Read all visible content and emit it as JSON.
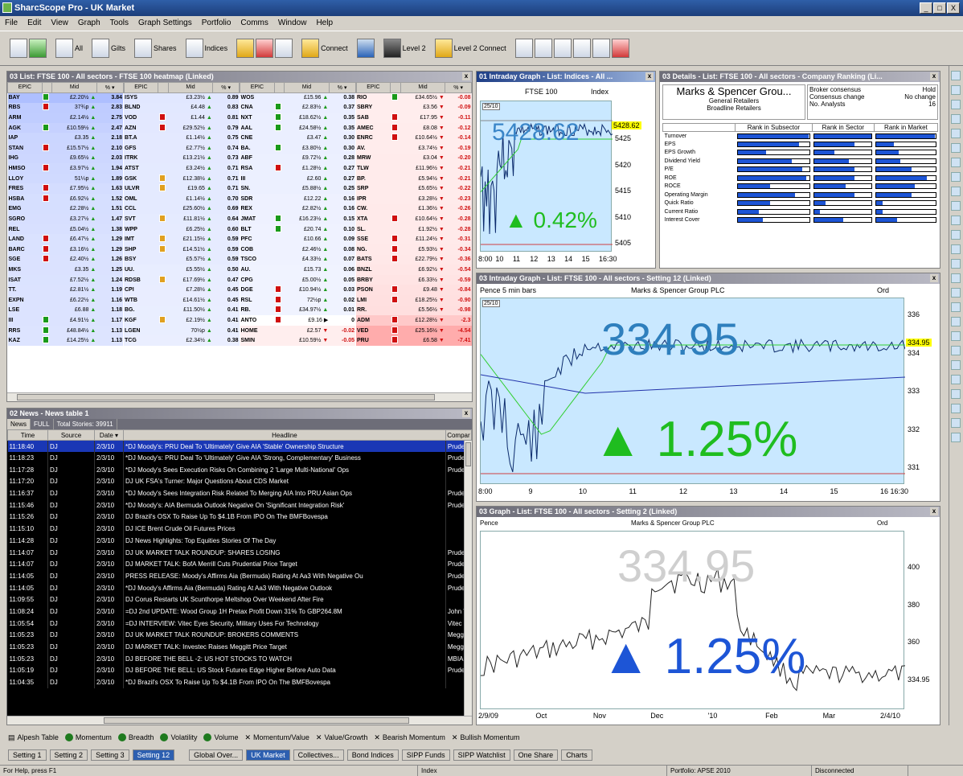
{
  "app": {
    "title": "SharcScope Pro - UK Market",
    "controls": [
      "_",
      "□",
      "X"
    ]
  },
  "menu": [
    "File",
    "Edit",
    "View",
    "Graph",
    "Tools",
    "Graph Settings",
    "Portfolio",
    "Comms",
    "Window",
    "Help"
  ],
  "toolbar": {
    "all": "All",
    "gilts": "Gilts",
    "shares": "Shares",
    "indices": "Indices",
    "connect": "Connect",
    "level2": "Level 2",
    "level2connect": "Level 2 Connect"
  },
  "heatmap": {
    "title": "03 List: FTSE 100 - All sectors - FTSE 100 heatmap (Linked)",
    "headers": [
      "EPIC",
      "",
      "Mid",
      "% ▾"
    ],
    "columns": [
      [
        [
          "BAY",
          "up",
          "£2.20½",
          "▲",
          "3.84"
        ],
        [
          "RBS",
          "dn",
          "37¾p",
          "▲",
          "2.83"
        ],
        [
          "ARM",
          "",
          "£2.14½",
          "▲",
          "2.75"
        ],
        [
          "AGK",
          "up",
          "£10.59½",
          "▲",
          "2.47"
        ],
        [
          "IAP",
          "",
          "£3.35",
          "▲",
          "2.18"
        ],
        [
          "STAN",
          "dn",
          "£15.57½",
          "▲",
          "2.10"
        ],
        [
          "IHG",
          "",
          "£9.65½",
          "▲",
          "2.03"
        ],
        [
          "HMSO",
          "dn",
          "£3.97½",
          "▲",
          "1.94"
        ],
        [
          "LLOY",
          "",
          "51¼p",
          "▲",
          "1.89"
        ],
        [
          "FRES",
          "dn",
          "£7.95½",
          "▲",
          "1.63"
        ],
        [
          "HSBA",
          "dn",
          "£6.92½",
          "▲",
          "1.52"
        ],
        [
          "EMG",
          "",
          "£2.28½",
          "▲",
          "1.51"
        ],
        [
          "SGRO",
          "",
          "£3.27½",
          "▲",
          "1.47"
        ],
        [
          "REL",
          "",
          "£5.04½",
          "▲",
          "1.38"
        ],
        [
          "LAND",
          "dn",
          "£6.47½",
          "▲",
          "1.29"
        ],
        [
          "BARC",
          "dn",
          "£3.16½",
          "▲",
          "1.29"
        ],
        [
          "SGE",
          "dn",
          "£2.40½",
          "▲",
          "1.26"
        ],
        [
          "MKS",
          "",
          "£3.35",
          "▲",
          "1.25"
        ],
        [
          "ISAT",
          "",
          "£7.52½",
          "▲",
          "1.24"
        ],
        [
          "TT.",
          "",
          "£2.81½",
          "▲",
          "1.19"
        ],
        [
          "EXPN",
          "",
          "£6.22½",
          "▲",
          "1.16"
        ],
        [
          "LSE",
          "",
          "£6.88",
          "▲",
          "1.18"
        ],
        [
          "III",
          "up",
          "£4.91½",
          "▲",
          "1.17"
        ],
        [
          "RRS",
          "up",
          "£48.84½",
          "▲",
          "1.13"
        ],
        [
          "KAZ",
          "up",
          "£14.25½",
          "▲",
          "1.13"
        ]
      ],
      [
        [
          "ISYS",
          "",
          "£3.23½",
          "▲",
          "0.89"
        ],
        [
          "BLND",
          "",
          "£4.48",
          "▲",
          "0.83"
        ],
        [
          "VOD",
          "dn",
          "£1.44",
          "▲",
          "0.81"
        ],
        [
          "AZN",
          "dn",
          "£29.52½",
          "▲",
          "0.79"
        ],
        [
          "BT.A",
          "",
          "£1.14½",
          "▲",
          "0.75"
        ],
        [
          "GFS",
          "",
          "£2.77½",
          "▲",
          "0.74"
        ],
        [
          "ITRK",
          "",
          "£13.21½",
          "▲",
          "0.73"
        ],
        [
          "ATST",
          "",
          "£3.24½",
          "▲",
          "0.71"
        ],
        [
          "GSK",
          "y",
          "£12.38½",
          "▲",
          "0.71"
        ],
        [
          "ULVR",
          "y",
          "£19.65",
          "▲",
          "0.71"
        ],
        [
          "OML",
          "",
          "£1.14½",
          "▲",
          "0.70"
        ],
        [
          "CCL",
          "",
          "£25.60½",
          "▲",
          "0.69"
        ],
        [
          "SVT",
          "y",
          "£11.81½",
          "▲",
          "0.64"
        ],
        [
          "WPP",
          "",
          "£6.25½",
          "▲",
          "0.60"
        ],
        [
          "IMT",
          "y",
          "£21.15½",
          "▲",
          "0.59"
        ],
        [
          "SHP",
          "y",
          "£14.51½",
          "▲",
          "0.59"
        ],
        [
          "BSY",
          "",
          "£5.57½",
          "▲",
          "0.59"
        ],
        [
          "UU.",
          "",
          "£5.55½",
          "▲",
          "0.50"
        ],
        [
          "RDSB",
          "y",
          "£17.69½",
          "▲",
          "0.47"
        ],
        [
          "CPI",
          "",
          "£7.28½",
          "▲",
          "0.45"
        ],
        [
          "WTB",
          "",
          "£14.61½",
          "▲",
          "0.45"
        ],
        [
          "BG.",
          "",
          "£11.50½",
          "▲",
          "0.41"
        ],
        [
          "KGF",
          "y",
          "£2.19½",
          "▲",
          "0.41"
        ],
        [
          "LGEN",
          "",
          "70½p",
          "▲",
          "0.41"
        ],
        [
          "TCG",
          "",
          "£2.34½",
          "▲",
          "0.38"
        ]
      ],
      [
        [
          "WOS",
          "",
          "£15.96",
          "▲",
          "0.38"
        ],
        [
          "CNA",
          "up",
          "£2.83½",
          "▲",
          "0.37"
        ],
        [
          "NXT",
          "up",
          "£18.62½",
          "▲",
          "0.35"
        ],
        [
          "AAL",
          "up",
          "£24.58½",
          "▲",
          "0.35"
        ],
        [
          "CNE",
          "",
          "£3.47",
          "▲",
          "0.30"
        ],
        [
          "BA.",
          "up",
          "£3.80½",
          "▲",
          "0.30"
        ],
        [
          "ABF",
          "",
          "£9.72½",
          "▲",
          "0.28"
        ],
        [
          "RSA",
          "dn",
          "£1.28½",
          "▲",
          "0.27"
        ],
        [
          "III",
          "",
          "£2.60",
          "▲",
          "0.27"
        ],
        [
          "SN.",
          "",
          "£5.88½",
          "▲",
          "0.25"
        ],
        [
          "SDR",
          "",
          "£12.22",
          "▲",
          "0.16"
        ],
        [
          "REX",
          "",
          "£2.82½",
          "▲",
          "0.16"
        ],
        [
          "JMAT",
          "up",
          "£16.23½",
          "▲",
          "0.15"
        ],
        [
          "BLT",
          "up",
          "£20.74",
          "▲",
          "0.10"
        ],
        [
          "PFC",
          "",
          "£10.66",
          "▲",
          "0.09"
        ],
        [
          "COB",
          "",
          "£2.46½",
          "▲",
          "0.08"
        ],
        [
          "TSCO",
          "",
          "£4.33½",
          "▲",
          "0.07"
        ],
        [
          "AU.",
          "",
          "£15.73",
          "▲",
          "0.06"
        ],
        [
          "CPG",
          "",
          "£5.00½",
          "▲",
          "0.05"
        ],
        [
          "DGE",
          "dn",
          "£10.94½",
          "▲",
          "0.03"
        ],
        [
          "RSL",
          "dn",
          "72½p",
          "▲",
          "0.02"
        ],
        [
          "RB.",
          "dn",
          "£34.97½",
          "▲",
          "0.01"
        ],
        [
          "ANTO",
          "dn",
          "£9.16",
          "▶",
          "0"
        ],
        [
          "HOME",
          "",
          "£2.57",
          "▼",
          "-0.02"
        ],
        [
          "SMIN",
          "",
          "£10.59½",
          "▼",
          "-0.05"
        ]
      ],
      [
        [
          "RIO",
          "up",
          "£34.65½",
          "▼",
          "-0.08"
        ],
        [
          "SBRY",
          "",
          "£3.56",
          "▼",
          "-0.09"
        ],
        [
          "SAB",
          "dn",
          "£17.95",
          "▼",
          "-0.11"
        ],
        [
          "AMEC",
          "dn",
          "£8.08",
          "▼",
          "-0.12"
        ],
        [
          "ENRC",
          "dn",
          "£10.64½",
          "▼",
          "-0.14"
        ],
        [
          "AV.",
          "",
          "£3.74½",
          "▼",
          "-0.19"
        ],
        [
          "MRW",
          "",
          "£3.04",
          "▼",
          "-0.20"
        ],
        [
          "TLW",
          "",
          "£11.96½",
          "▼",
          "-0.21"
        ],
        [
          "BP.",
          "",
          "£5.94½",
          "▼",
          "-0.21"
        ],
        [
          "SRP",
          "",
          "£5.65½",
          "▼",
          "-0.22"
        ],
        [
          "IPR",
          "",
          "£3.28½",
          "▼",
          "-0.23"
        ],
        [
          "CW.",
          "",
          "£1.36½",
          "▼",
          "-0.26"
        ],
        [
          "XTA",
          "dn",
          "£10.64½",
          "▼",
          "-0.28"
        ],
        [
          "SL.",
          "",
          "£1.92½",
          "▼",
          "-0.28"
        ],
        [
          "SSE",
          "dn",
          "£11.24½",
          "▼",
          "-0.31"
        ],
        [
          "NG.",
          "dn",
          "£5.93½",
          "▼",
          "-0.34"
        ],
        [
          "BATS",
          "dn",
          "£22.79½",
          "▼",
          "-0.36"
        ],
        [
          "BNZL",
          "",
          "£6.92½",
          "▼",
          "-0.54"
        ],
        [
          "BRBY",
          "",
          "£6.33½",
          "▼",
          "-0.59"
        ],
        [
          "PSON",
          "dn",
          "£9.48",
          "▼",
          "-0.84"
        ],
        [
          "LMI",
          "dn",
          "£18.25½",
          "▼",
          "-0.90"
        ],
        [
          "RR.",
          "",
          "£5.56½",
          "▼",
          "-0.98"
        ],
        [
          "ADM",
          "dn",
          "£12.28½",
          "▼",
          "-2.3"
        ],
        [
          "VED",
          "dn",
          "£25.16½",
          "▼",
          "-4.54"
        ],
        [
          "PRU",
          "dn",
          "£6.58",
          "▼",
          "-7.41"
        ]
      ]
    ]
  },
  "intraday1": {
    "title": "01 Intraday Graph - List: Indices - All ...",
    "name": "FTSE 100",
    "label": "Index",
    "price": "5428.62",
    "change": "▲ 0.42%",
    "ytick": [
      "5425",
      "5420",
      "5415",
      "5410",
      "5405"
    ],
    "xtick": [
      "8:00",
      "10",
      "11",
      "12",
      "13",
      "14",
      "15",
      "16:30"
    ],
    "badge": "5428.62",
    "box": "25/10"
  },
  "details": {
    "title": "03 Details - List: FTSE 100 - All sectors - Company Ranking (Li...",
    "company": "Marks & Spencer Grou...",
    "sector": "General Retailers",
    "subsector": "Broadline Retailers",
    "broker": [
      "Broker consensus",
      "Consensus change",
      "No. Analysts"
    ],
    "brokerval": [
      "Hold",
      "No change",
      "16"
    ],
    "cols": [
      "Rank in Subsector",
      "Rank in Sector",
      "Rank in Market"
    ],
    "rows": [
      [
        "Turnover",
        0.99,
        0.99,
        0.99
      ],
      [
        "EPS",
        0.85,
        0.7,
        0.3
      ],
      [
        "EPS Growth",
        0.4,
        0.35,
        0.38
      ],
      [
        "Dividend Yield",
        0.75,
        0.6,
        0.4
      ],
      [
        "P/E",
        0.9,
        0.7,
        0.6
      ],
      [
        "ROE",
        0.95,
        0.7,
        0.85
      ],
      [
        "ROCE",
        0.45,
        0.55,
        0.65
      ],
      [
        "Operating Margin",
        0.8,
        0.7,
        0.6
      ],
      [
        "Quick Ratio",
        0.45,
        0.2,
        0.1
      ],
      [
        "Current Ratio",
        0.3,
        0.1,
        0.1
      ],
      [
        "Interest Cover",
        0.35,
        0.5,
        0.35
      ]
    ]
  },
  "intraday2": {
    "title": "03 Intraday Graph - List: FTSE 100 - All sectors - Setting 12 (Linked)",
    "unit": "Pence 5 min bars",
    "name": "Marks & Spencer Group PLC",
    "ord": "Ord",
    "price": "334.95",
    "change": "▲ 1.25%",
    "ytick": [
      "336",
      "334",
      "333",
      "332",
      "331"
    ],
    "xtick": [
      "8:00",
      "9",
      "10",
      "11",
      "12",
      "13",
      "14",
      "15",
      "16 16:30"
    ],
    "badge": "334.95",
    "box": "25/10"
  },
  "graph3": {
    "title": "03 Graph - List: FTSE 100 - All sectors - Setting 2 (Linked)",
    "unit": "Pence",
    "name": "Marks & Spencer Group PLC",
    "ord": "Ord",
    "price": "334.95",
    "change": "▲ 1.25%",
    "ytick": [
      "400",
      "380",
      "360",
      "334.95"
    ],
    "xtick": [
      "2/9/09",
      "Oct",
      "Nov",
      "Dec",
      "'10",
      "Feb",
      "Mar",
      "2/4/10"
    ]
  },
  "news": {
    "title": "02 News - News table 1",
    "tabs": [
      "News",
      "FULL",
      "Total Stories: 39911"
    ],
    "cols": [
      "Time",
      "Source",
      "Date ▾",
      "Headline",
      "Compar"
    ],
    "rows": [
      [
        "11:18:40",
        "DJ",
        "2/3/10",
        "*DJ Moody's: PRU Deal To 'Ultimately' Give AIA 'Stable' Ownership Structure",
        "Pruder"
      ],
      [
        "11:18:23",
        "DJ",
        "2/3/10",
        "*DJ Moody's: PRU Deal To 'Ultimately' Give AIA 'Strong, Complementary' Business",
        "Pruder"
      ],
      [
        "11:17:28",
        "DJ",
        "2/3/10",
        "*DJ Moody's Sees Execution Risks On Combining 2 'Large Multi-National' Ops",
        "Pruder"
      ],
      [
        "11:17:20",
        "DJ",
        "2/3/10",
        "DJ UK FSA's Turner: Major Questions About CDS Market",
        ""
      ],
      [
        "11:16:37",
        "DJ",
        "2/3/10",
        "*DJ Moody's Sees Integration Risk Related To Merging AIA Into PRU Asian Ops",
        "Pruder"
      ],
      [
        "11:15:46",
        "DJ",
        "2/3/10",
        "*DJ Moody's: AIA Bermuda Outlook Negative On 'Significant Integration Risk'",
        "Pruder"
      ],
      [
        "11:15:26",
        "DJ",
        "2/3/10",
        "DJ Brazil's OSX To Raise Up To $4.1B From IPO On The BMFBovespa",
        ""
      ],
      [
        "11:15:10",
        "DJ",
        "2/3/10",
        "DJ ICE Brent Crude Oil Futures Prices",
        ""
      ],
      [
        "11:14:28",
        "DJ",
        "2/3/10",
        "DJ News Highlights: Top Equities Stories Of The Day",
        ""
      ],
      [
        "11:14:07",
        "DJ",
        "2/3/10",
        "DJ UK MARKET TALK ROUNDUP: SHARES LOSING",
        "Pruder"
      ],
      [
        "11:14:07",
        "DJ",
        "2/3/10",
        "DJ MARKET TALK: BofA Merrill Cuts Prudential Price Target",
        "Pruder"
      ],
      [
        "11:14:05",
        "DJ",
        "2/3/10",
        "PRESS RELEASE: Moody's Affirms Aia (Bermuda) Rating At Aa3 With Negative Ou",
        "Pruder"
      ],
      [
        "11:14:05",
        "DJ",
        "2/3/10",
        "*DJ Moody's Affirms Aia (Bermuda) Rating At Aa3 With Negative Outlook",
        "Pruder"
      ],
      [
        "11:09:55",
        "DJ",
        "2/3/10",
        "DJ Corus Restarts UK Scunthorpe Meltshop Over Weekend After Fire",
        ""
      ],
      [
        "11:08:24",
        "DJ",
        "2/3/10",
        "=DJ 2nd UPDATE: Wood Group 1H Pretax Profit Down 31% To GBP264.8M",
        "John W"
      ],
      [
        "11:05:54",
        "DJ",
        "2/3/10",
        "=DJ INTERVIEW: Vitec Eyes Security, Military Uses For Technology",
        "Vitec C"
      ],
      [
        "11:05:23",
        "DJ",
        "2/3/10",
        "DJ UK MARKET TALK ROUNDUP: BROKERS COMMENTS",
        "Meggit"
      ],
      [
        "11:05:23",
        "DJ",
        "2/3/10",
        "DJ MARKET TALK: Investec Raises Meggitt Price Target",
        "Meggit"
      ],
      [
        "11:05:23",
        "DJ",
        "2/3/10",
        "DJ BEFORE THE BELL -2: US HOT STOCKS TO WATCH",
        "MBIA I"
      ],
      [
        "11:05:19",
        "DJ",
        "2/3/10",
        "DJ BEFORE THE BELL: US Stock Futures Edge Higher Before Auto Data",
        "Pruder"
      ],
      [
        "11:04:35",
        "DJ",
        "2/3/10",
        "*DJ Brazil's OSX To Raise Up To $4.1B From IPO On The BMFBovespa",
        ""
      ]
    ]
  },
  "screens": [
    "Alpesh Table",
    "Momentum",
    "Breadth",
    "Volatility",
    "Volume",
    "Momentum/Value",
    "Value/Growth",
    "Bearish Momentum",
    "Bullish Momentum"
  ],
  "workspaces": [
    "Setting 1",
    "Setting 2",
    "Setting 3",
    "Setting 12",
    "Global Over...",
    "UK Market",
    "Collectives...",
    "Bond Indices",
    "SIPP Funds",
    "SIPP Watchlist",
    "One Share",
    "Charts"
  ],
  "status": [
    "For Help, press F1",
    "Index",
    "Portfolio: APSE 2010",
    "Disconnected"
  ],
  "colors": {
    "up": "#1a9a1a",
    "down": "#d01010",
    "heatUp": "#c9d7ff",
    "heatDown": "#ffbcbc",
    "chartBg": "#c9e8ff",
    "accentBlue": "#1d55d6"
  }
}
